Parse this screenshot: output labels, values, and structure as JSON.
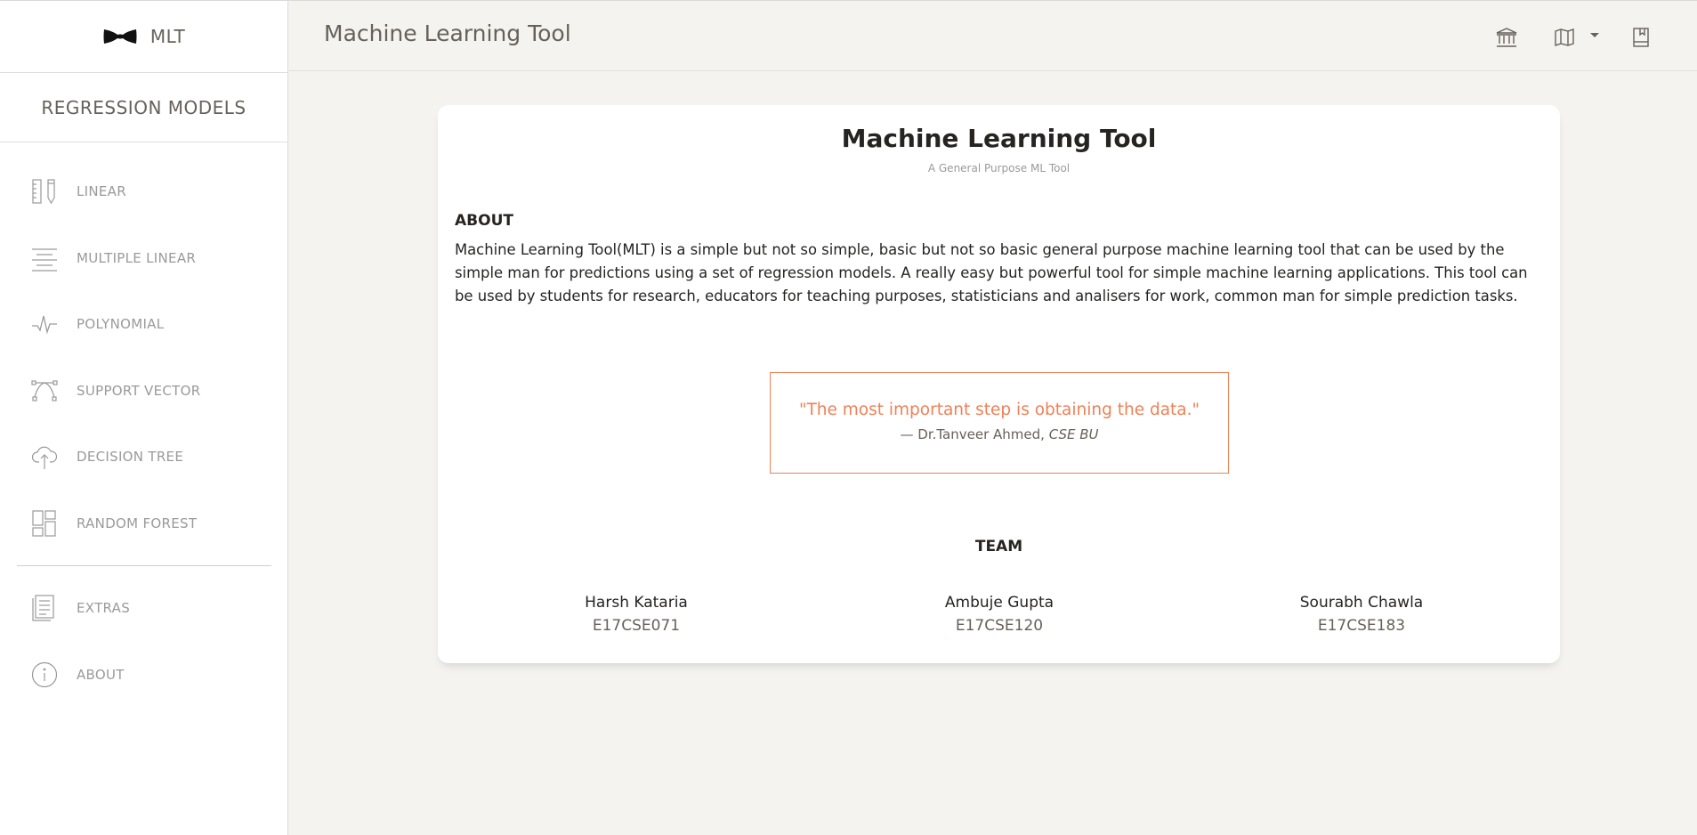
{
  "brand": {
    "name": "MLT",
    "logo_icon": "bowtie-icon"
  },
  "sidebar": {
    "section_title": "REGRESSION MODELS",
    "items": [
      {
        "label": "LINEAR",
        "icon": "ruler-pencil-icon"
      },
      {
        "label": "MULTIPLE LINEAR",
        "icon": "align-center-icon"
      },
      {
        "label": "POLYNOMIAL",
        "icon": "pulse-icon"
      },
      {
        "label": "SUPPORT VECTOR",
        "icon": "bezier-curve-icon"
      },
      {
        "label": "DECISION TREE",
        "icon": "cloud-upload-icon"
      },
      {
        "label": "RANDOM FOREST",
        "icon": "layout-grid-icon"
      }
    ],
    "extra_items": [
      {
        "label": "EXTRAS",
        "icon": "document-icon"
      },
      {
        "label": "ABOUT",
        "icon": "info-icon"
      }
    ]
  },
  "topbar": {
    "title": "Machine Learning Tool",
    "icons": [
      "bank-icon",
      "map-icon",
      "book-icon"
    ]
  },
  "card": {
    "title": "Machine Learning Tool",
    "subtitle": "A General Purpose ML Tool",
    "about_heading": "ABOUT",
    "about_text": "Machine Learning Tool(MLT) is a simple but not so simple, basic but not so basic general purpose machine learning tool that can be used by the simple man for predictions using a set of regression models. A really easy but powerful tool for simple machine learning applications. This tool can be used by students for research, educators for teaching purposes, statisticians and analisers for work, common man for simple prediction tasks.",
    "quote": {
      "text": "\"The most important step is obtaining the data.\"",
      "author": "— Dr.Tanveer Ahmed,",
      "affiliation": "CSE BU"
    },
    "team_heading": "TEAM",
    "team": [
      {
        "name": "Harsh Kataria",
        "id": "E17CSE071"
      },
      {
        "name": "Ambuje Gupta",
        "id": "E17CSE120"
      },
      {
        "name": "Sourabh Chawla",
        "id": "E17CSE183"
      }
    ]
  },
  "colors": {
    "accent": "#ef8157",
    "muted": "#9a9a9a",
    "text": "#252422",
    "background": "#f4f3ef"
  }
}
